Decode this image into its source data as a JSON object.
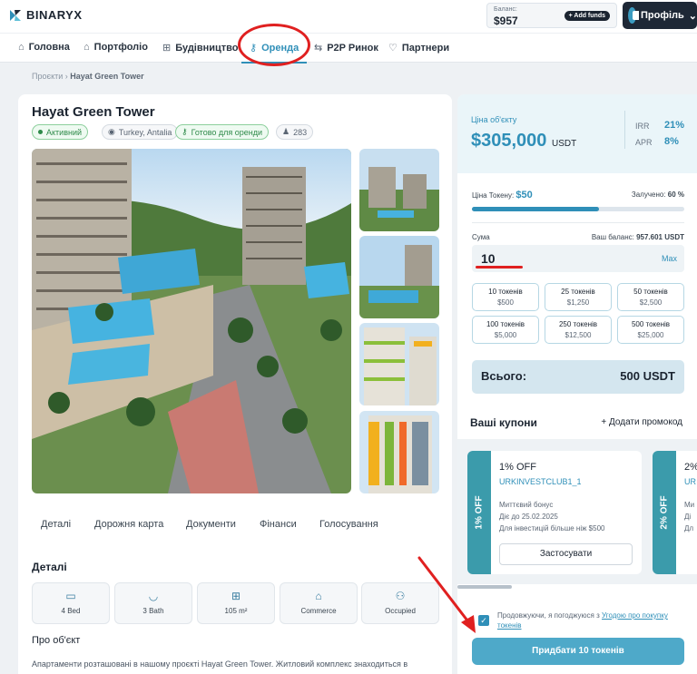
{
  "app": {
    "logo": "BINARYX"
  },
  "header": {
    "balance_label": "Баланс:",
    "balance_value": "$957",
    "add_funds": "+ Add funds",
    "profile": "Профіль"
  },
  "nav": {
    "items": [
      {
        "label": "Головна",
        "icon": "home-icon"
      },
      {
        "label": "Портфоліо",
        "icon": "portfolio-icon"
      },
      {
        "label": "Будівництво",
        "icon": "construction-icon"
      },
      {
        "label": "Оренда",
        "icon": "key-icon"
      },
      {
        "label": "P2P Ринок",
        "icon": "swap-icon"
      },
      {
        "label": "Партнери",
        "icon": "handshake-icon"
      }
    ],
    "active": "Оренда"
  },
  "breadcrumb": {
    "root": "Проєкти",
    "current": "Hayat Green Tower"
  },
  "property": {
    "title": "Hayat Green Tower",
    "badges": {
      "status": "Активний",
      "location": "Turkey, Antalia",
      "rent": "Готово для оренди",
      "investors": "283"
    },
    "tabs": [
      "Деталі",
      "Дорожня карта",
      "Документи",
      "Фінанси",
      "Голосування"
    ],
    "details_title": "Деталі",
    "features": [
      "4 Bed",
      "3 Bath",
      "105 m²",
      "Commerce",
      "Occupied"
    ],
    "about_title": "Про об'єкт",
    "description": "Апартаменти розташовані в нашому проєкті Hayat Green Tower. Житловий комплекс знаходиться в"
  },
  "invest": {
    "object_price_label": "Ціна об'єкту",
    "object_price": "$305,000",
    "currency": "USDT",
    "irr_label": "IRR",
    "irr": "21%",
    "apr_label": "APR",
    "apr": "8%",
    "token_price_label": "Ціна Токену:",
    "token_price": "$50",
    "raised_label": "Залучено:",
    "raised": "60 %",
    "progress": 0.6,
    "sum_label": "Сума",
    "balance_label": "Ваш баланс:",
    "balance": "957.601 USDT",
    "amount": "10",
    "max": "Max",
    "options": [
      {
        "tokens": "10 токенів",
        "price": "$500"
      },
      {
        "tokens": "25 токенів",
        "price": "$1,250"
      },
      {
        "tokens": "50 токенів",
        "price": "$2,500"
      },
      {
        "tokens": "100 токенів",
        "price": "$5,000"
      },
      {
        "tokens": "250 токенів",
        "price": "$12,500"
      },
      {
        "tokens": "500 токенів",
        "price": "$25,000"
      }
    ],
    "total_label": "Всього:",
    "total": "500 USDT",
    "coupons_title": "Ваші купони",
    "add_promo": "+ Додати промокод",
    "coupons": [
      {
        "side": "1% OFF",
        "title": "1% OFF",
        "code": "URKINVESTCLUB1_1",
        "l1": "Миттєвий бонус",
        "l2": "Діє до 25.02.2025",
        "l3": "Для інвестицій більше ніж $500",
        "apply": "Застосувати"
      },
      {
        "side": "2% OFF",
        "title": "2%",
        "code": "UR",
        "l1": "Ми",
        "l2": "Ді",
        "l3": "Дл"
      }
    ],
    "agree_text": "Продовжуючи, я погоджуюся з ",
    "agree_link": "Угодою про покупку токенів",
    "buy": "Придбати 10 токенів"
  },
  "colors": {
    "accent": "#2f8fb8",
    "annotation": "#e02020"
  }
}
